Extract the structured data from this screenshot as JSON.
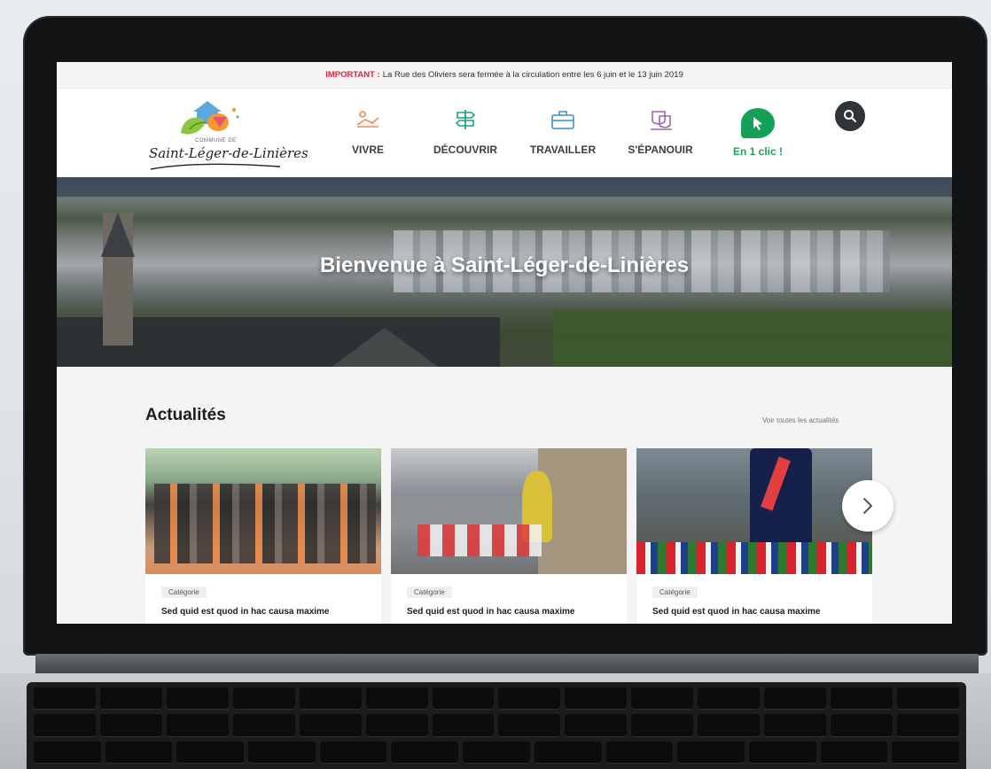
{
  "alert": {
    "label": "IMPORTANT :",
    "text": "La Rue des Oliviers sera fermée à la circulation entre les 6 juin et le 13 juin 2019"
  },
  "logo": {
    "top_text": "COMMUNE DE",
    "name": "Saint-Léger-de-Linières"
  },
  "nav": {
    "items": [
      {
        "label": "VIVRE",
        "icon": "person-reading-icon"
      },
      {
        "label": "DÉCOUVRIR",
        "icon": "signpost-icon"
      },
      {
        "label": "TRAVAILLER",
        "icon": "briefcase-icon"
      },
      {
        "label": "S'ÉPANOUIR",
        "icon": "theater-icon"
      },
      {
        "label": "En 1 clic !",
        "icon": "cursor-click-icon"
      }
    ]
  },
  "hero": {
    "title": "Bienvenue à Saint-Léger-de-Linières"
  },
  "news": {
    "title": "Actualités",
    "see_all": "Voir toutes les actualités",
    "cards": [
      {
        "category": "Catégorie",
        "title": "Sed quid est quod in hac causa maxime"
      },
      {
        "category": "Catégorie",
        "title": "Sed quid est quod in hac causa maxime"
      },
      {
        "category": "Catégorie",
        "title": "Sed quid est quod in hac causa maxime"
      }
    ]
  },
  "colors": {
    "accent_green": "#14a056",
    "alert_red": "#e2233f",
    "nav_text": "#3b3e45"
  }
}
